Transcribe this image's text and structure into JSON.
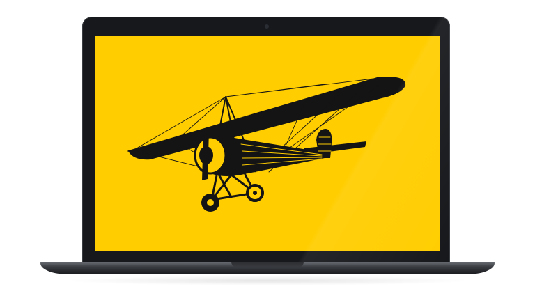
{
  "scene": {
    "subject": "laptop",
    "wallpaper_icon": "vintage-monoplane-illustration"
  },
  "colors": {
    "screen_background": "#FFCD00",
    "ink": "#141414",
    "laptop_body": "#16181b",
    "laptop_base": "#3e4146",
    "page_background": "#ffffff"
  }
}
